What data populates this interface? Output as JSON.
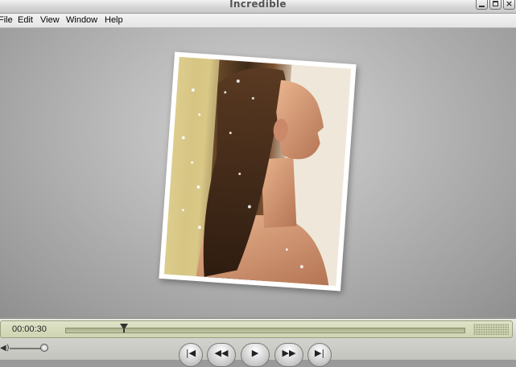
{
  "window": {
    "title": "Incredible"
  },
  "menu": {
    "items": [
      "File",
      "Edit",
      "View",
      "Window",
      "Help"
    ]
  },
  "controls": {
    "time": "00:00:30",
    "playback_progress": 0.15,
    "volume_level": 0.85,
    "buttons": [
      "skip-to-start",
      "rewind",
      "play",
      "fast-forward",
      "skip-to-end"
    ]
  },
  "icons": {
    "minimize": "minimize-icon",
    "maximize": "maximize-icon",
    "close": "close-icon",
    "volume": "speaker-icon"
  },
  "colors": {
    "timebar": "#cfd4b2",
    "video_bg": "#bdbdbd"
  }
}
